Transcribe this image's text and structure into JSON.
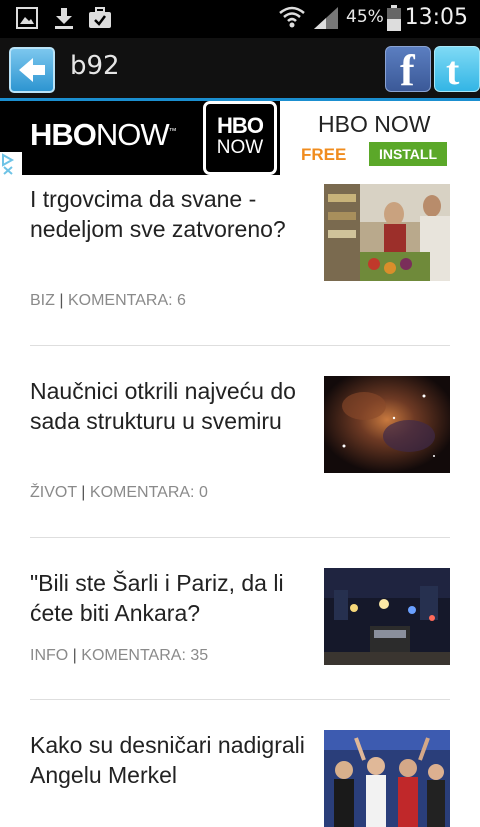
{
  "status_bar": {
    "battery": "45%",
    "time": "13:05",
    "icons": [
      "gallery-icon",
      "download-icon",
      "briefcase-icon",
      "wifi-icon",
      "signal-icon",
      "battery-icon"
    ]
  },
  "action_bar": {
    "title": "b92",
    "back_icon": "back-arrow-icon",
    "facebook_letter": "f",
    "twitter_letter": "t"
  },
  "ad": {
    "wordmark_bold": "HBO",
    "wordmark_light": "NOW",
    "wordmark_tm": "™",
    "logo_line1": "HBO",
    "logo_line2": "NOW",
    "name": "HBO NOW",
    "free_label": "FREE",
    "install_label": "INSTALL",
    "adchoice_icon": "adchoices-icon"
  },
  "articles": [
    {
      "title": "I trgovcima da svane - nedeljom sve zatvoreno?",
      "category": "BIZ",
      "separator": "|",
      "comments": "KOMENTARA: 6"
    },
    {
      "title": "Naučnici otkrili najveću do sada strukturu u svemiru",
      "category": "ŽIVOT",
      "separator": "|",
      "comments": "KOMENTARA: 0"
    },
    {
      "title": "\"Bili ste Šarli i Pariz, da li ćete biti Ankara?",
      "category": "INFO",
      "separator": "|",
      "comments": "KOMENTARA: 35"
    },
    {
      "title": "Kako su desničari nadigrali Angelu Merkel",
      "category": "",
      "separator": "",
      "comments": ""
    }
  ]
}
